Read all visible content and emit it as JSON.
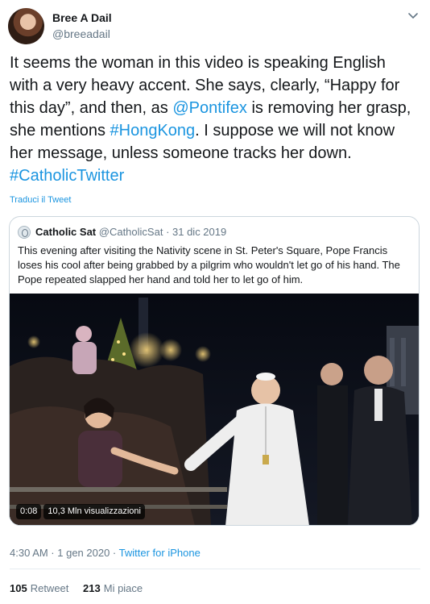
{
  "author": {
    "name": "Bree A Dail",
    "handle": "@breeadail"
  },
  "tweet": {
    "part1": "It seems the woman in this video is speaking English with a very heavy accent. She says, clearly, “Happy for this day”, and then, as ",
    "mention": "@Pontifex",
    "part2": " is removing her grasp, she mentions ",
    "hashtag1": "#HongKong",
    "part3": ". I suppose we will not know her message, unless someone tracks her down. ",
    "hashtag2": "#CatholicTwitter"
  },
  "translate_label": "Traduci il Tweet",
  "quoted": {
    "name": "Catholic Sat",
    "handle": "@CatholicSat",
    "date": "· 31 dic 2019",
    "text": "This evening after visiting the Nativity scene in St. Peter's Square, Pope Francis loses his cool after being grabbed by a pilgrim who wouldn't let go of his hand. The Pope repeated slapped her hand and told her to let go of him.",
    "video": {
      "time": "0:08",
      "views": "10,3 Mln visualizzazioni"
    }
  },
  "timestamp": {
    "time": "4:30 AM · 1 gen 2020 · ",
    "source": "Twitter for iPhone"
  },
  "stats": {
    "retweets": "105",
    "retweets_label": "Retweet",
    "likes": "213",
    "likes_label": "Mi piace"
  },
  "colors": {
    "link": "#1b95e0",
    "secondary_text": "#657786",
    "border": "#ccd6dd"
  }
}
